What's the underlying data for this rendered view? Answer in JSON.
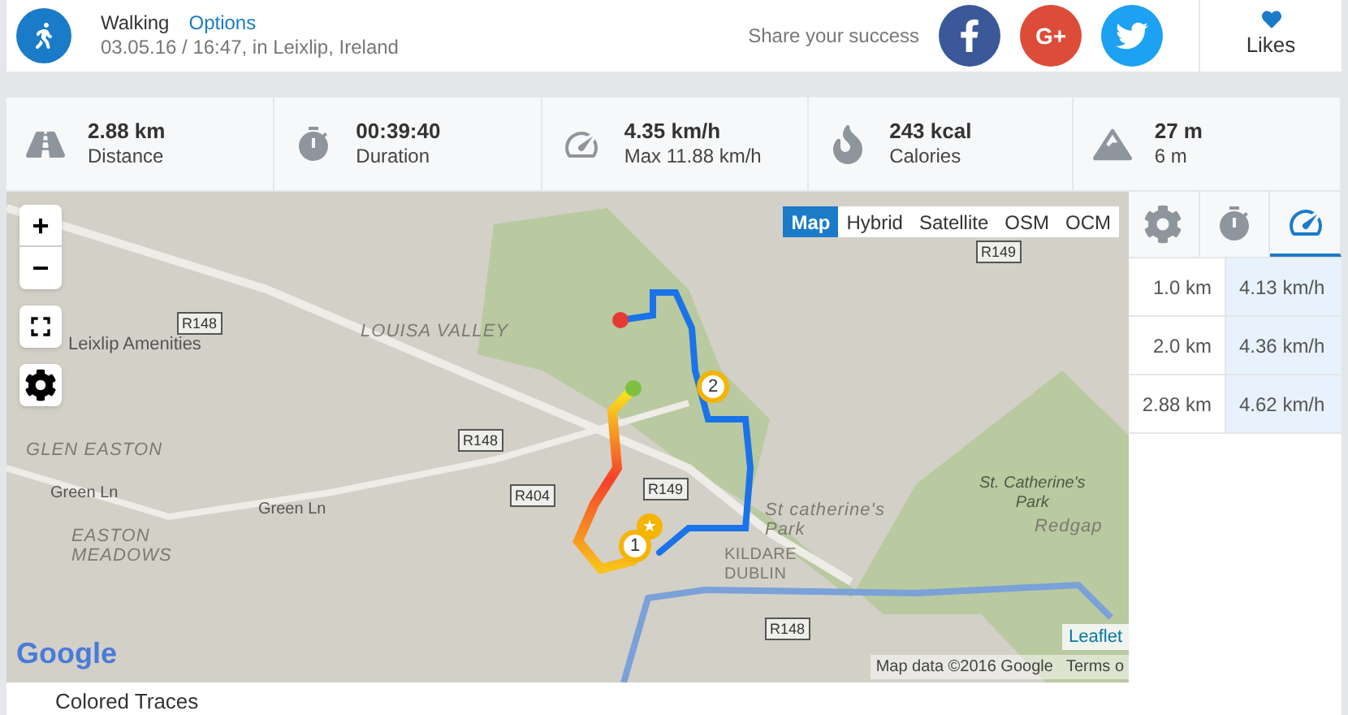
{
  "header": {
    "activity": "Walking",
    "options": "Options",
    "meta": "03.05.16 / 16:47, in Leixlip, Ireland",
    "share_label": "Share your success",
    "share_buttons": [
      {
        "kind": "facebook"
      },
      {
        "kind": "google",
        "label": "G+"
      },
      {
        "kind": "twitter"
      }
    ],
    "likes": "Likes"
  },
  "stats": [
    {
      "kind": "distance",
      "value": "2.88 km",
      "label": "Distance"
    },
    {
      "kind": "duration",
      "value": "00:39:40",
      "label": "Duration"
    },
    {
      "kind": "speed",
      "value": "4.35 km/h",
      "label": "Max 11.88 km/h"
    },
    {
      "kind": "calories",
      "value": "243 kcal",
      "label": "Calories"
    },
    {
      "kind": "elevation",
      "value": "27 m",
      "label": "6 m"
    }
  ],
  "map": {
    "layers": [
      {
        "label": "Map",
        "selected": true
      },
      {
        "label": "Hybrid",
        "selected": false
      },
      {
        "label": "Satellite",
        "selected": false
      },
      {
        "label": "OSM",
        "selected": false
      },
      {
        "label": "OCM",
        "selected": false
      }
    ],
    "zoom_in": "+",
    "zoom_out": "−",
    "labels": [
      {
        "text": "R149",
        "kind": "road"
      },
      {
        "text": "R148",
        "kind": "road"
      },
      {
        "text": "Leixlip Amenities",
        "kind": "place"
      },
      {
        "text": "LOUISA VALLEY",
        "kind": "area"
      },
      {
        "text": "R148",
        "kind": "road"
      },
      {
        "text": "GLEN EASTON",
        "kind": "area"
      },
      {
        "text": "Green Ln",
        "kind": "street"
      },
      {
        "text": "Green Ln",
        "kind": "street"
      },
      {
        "text": "R404",
        "kind": "road"
      },
      {
        "text": "R149",
        "kind": "road"
      },
      {
        "text": "St catherine's\nPark",
        "kind": "area"
      },
      {
        "text": "St. Catherine's\nPark",
        "kind": "park"
      },
      {
        "text": "Redgap",
        "kind": "area"
      },
      {
        "text": "EASTON\nMEADOWS",
        "kind": "area"
      },
      {
        "text": "KILDARE\nDUBLIN",
        "kind": "border"
      },
      {
        "text": "R148",
        "kind": "road"
      }
    ],
    "logo": "Google",
    "star": "★",
    "markers": [
      "1",
      "2"
    ],
    "attribution": "Leaflet",
    "map_data": "Map data ©2016 Google",
    "terms": "Terms o"
  },
  "splits": {
    "tabs": [
      {
        "kind": "settings",
        "selected": false
      },
      {
        "kind": "pace",
        "selected": false
      },
      {
        "kind": "speed",
        "selected": true
      }
    ],
    "rows": [
      {
        "distance": "1.0 km",
        "speed": "4.13 km/h"
      },
      {
        "distance": "2.0 km",
        "speed": "4.36 km/h"
      },
      {
        "distance": "2.88 km",
        "speed": "4.62 km/h"
      }
    ]
  },
  "footer": {
    "title": "Colored Traces"
  }
}
